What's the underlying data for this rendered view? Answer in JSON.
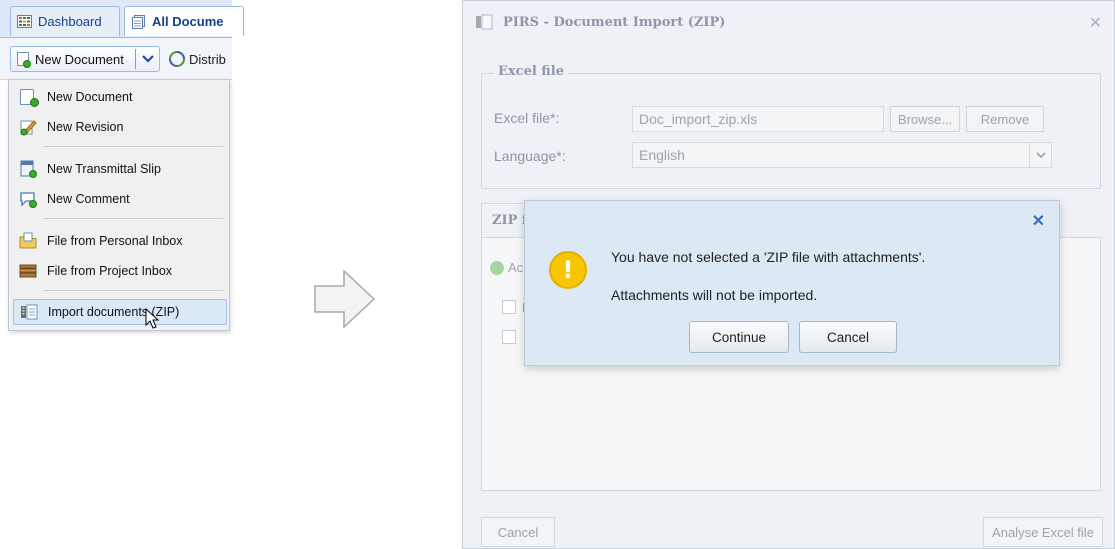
{
  "left": {
    "tabs": [
      {
        "label": "Dashboard",
        "icon": "dashboard-grid-icon"
      },
      {
        "label": "All Docume",
        "icon": "documents-icon"
      }
    ],
    "toolbar": {
      "new_document_label": "New Document",
      "dropdown_icon": "chevron-down-icon",
      "distribute_label": "Distrib"
    },
    "menu": {
      "items": [
        {
          "label": "New Document",
          "icon": "new-document-icon"
        },
        {
          "label": "New Revision",
          "icon": "new-revision-icon"
        },
        {
          "label": "New Transmittal Slip",
          "icon": "transmittal-slip-icon"
        },
        {
          "label": "New Comment",
          "icon": "comment-icon"
        },
        {
          "label": "File from Personal Inbox",
          "icon": "personal-inbox-folder-icon"
        },
        {
          "label": "File from Project Inbox",
          "icon": "project-inbox-icon"
        },
        {
          "label": "Import documents (ZIP)",
          "icon": "import-zip-icon",
          "selected": true
        }
      ]
    }
  },
  "dialog": {
    "title": "PIRS - Document Import (ZIP)",
    "close_icon": "close-icon",
    "excel_section": {
      "legend": "Excel file",
      "excel_file_label": "Excel file*:",
      "excel_file_value": "Doc_import_zip.xls",
      "browse_label": "Browse...",
      "remove_label": "Remove",
      "language_label": "Language*:",
      "language_value": "English"
    },
    "zip_tab_label": "ZIP f",
    "grid": {
      "add_label": "Ac",
      "header_text": "Fi"
    },
    "cancel_label": "Cancel",
    "analyse_label": "Analyse Excel file"
  },
  "alert": {
    "message_line1": "You have not selected a 'ZIP file with attachments'.",
    "message_line2": "Attachments will not be imported.",
    "continue_label": "Continue",
    "cancel_label": "Cancel",
    "icon": "warning-icon",
    "accent_color": "#f6c600"
  }
}
